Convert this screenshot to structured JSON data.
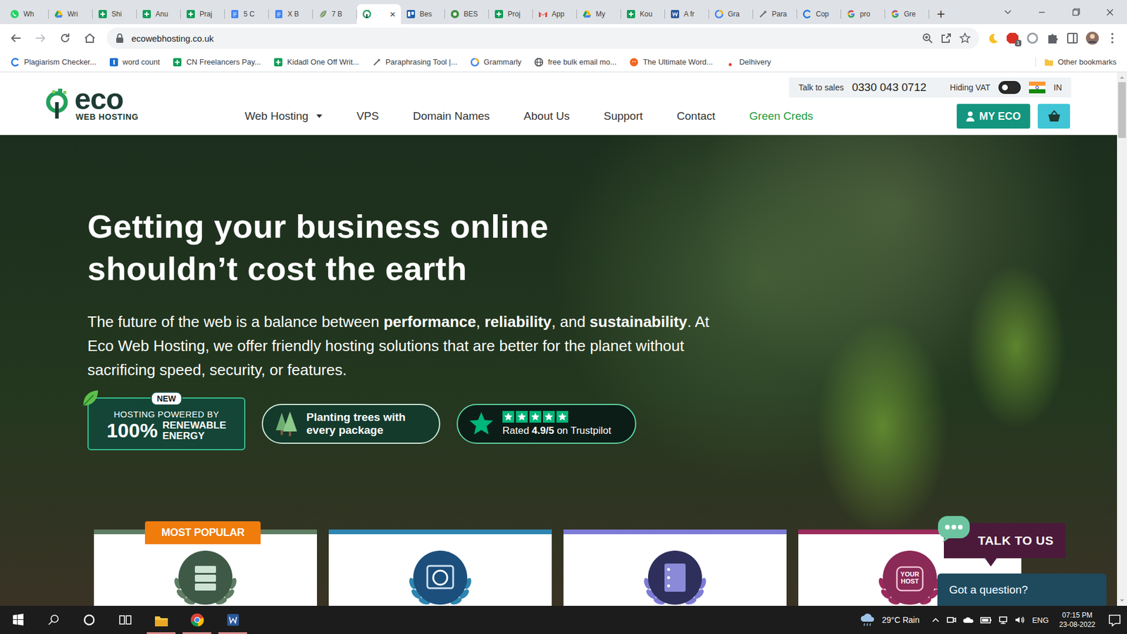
{
  "browser": {
    "tabs": [
      {
        "label": "Wh",
        "kind": "whatsapp",
        "selected": false
      },
      {
        "label": "Wri",
        "kind": "drive",
        "selected": false
      },
      {
        "label": "Shi",
        "kind": "sheets",
        "selected": false
      },
      {
        "label": "Anu",
        "kind": "sheets",
        "selected": false
      },
      {
        "label": "Praj",
        "kind": "sheets",
        "selected": false
      },
      {
        "label": "5 C",
        "kind": "docs",
        "selected": false
      },
      {
        "label": "X B",
        "kind": "docs",
        "selected": false
      },
      {
        "label": "7 B",
        "kind": "leaf",
        "selected": false
      },
      {
        "kind": "eco",
        "selected": true,
        "close": "×"
      },
      {
        "label": "Bes",
        "kind": "trello",
        "selected": false
      },
      {
        "label": "BES",
        "kind": "green-a",
        "selected": false
      },
      {
        "label": "Proj",
        "kind": "sheets",
        "selected": false
      },
      {
        "label": "App",
        "kind": "gmail",
        "selected": false
      },
      {
        "label": "My",
        "kind": "drive",
        "selected": false
      },
      {
        "label": "Kou",
        "kind": "sheets",
        "selected": false
      },
      {
        "label": "A fr",
        "kind": "word",
        "selected": false
      },
      {
        "label": "Gra",
        "kind": "ring",
        "selected": false
      },
      {
        "label": "Para",
        "kind": "pen",
        "selected": false
      },
      {
        "label": "Cop",
        "kind": "c",
        "selected": false
      },
      {
        "label": "pro",
        "kind": "google",
        "selected": false
      },
      {
        "label": "Gre",
        "kind": "google",
        "selected": false
      }
    ],
    "new_tab": "+",
    "address": "ecowebhosting.co.uk",
    "extension_badge": "1",
    "bookmarks": [
      {
        "label": "Plagiarism Checker...",
        "kind": "c"
      },
      {
        "label": "word count",
        "kind": "wordcount"
      },
      {
        "label": "CN Freelancers Pay...",
        "kind": "sheets"
      },
      {
        "label": "Kidadl One Off Writ...",
        "kind": "sheets"
      },
      {
        "label": "Paraphrasing Tool |...",
        "kind": "pen"
      },
      {
        "label": "Grammarly",
        "kind": "ring"
      },
      {
        "label": "free bulk email mo...",
        "kind": "globe"
      },
      {
        "label": "The Ultimate Word...",
        "kind": "orange"
      },
      {
        "label": "Delhivery",
        "kind": "dot"
      }
    ],
    "other_bookmarks": "Other bookmarks"
  },
  "site": {
    "sales_label": "Talk to sales",
    "sales_phone": "0330 043 0712",
    "vat": {
      "label": "Hiding VAT",
      "on": false
    },
    "country": "IN",
    "logo": {
      "word": "eco",
      "sub": "WEB HOSTING"
    },
    "nav": [
      {
        "label": "Web Hosting",
        "dropdown": true,
        "highlighted": false
      },
      {
        "label": "VPS",
        "dropdown": false,
        "highlighted": false
      },
      {
        "label": "Domain Names",
        "dropdown": false,
        "highlighted": false
      },
      {
        "label": "About Us",
        "dropdown": false,
        "highlighted": false
      },
      {
        "label": "Support",
        "dropdown": false,
        "highlighted": false
      },
      {
        "label": "Contact",
        "dropdown": false,
        "highlighted": false
      },
      {
        "label": "Green Creds",
        "dropdown": false,
        "highlighted": true
      }
    ],
    "account_button": "MY ECO",
    "hero": {
      "heading": [
        "Getting your business online",
        "shouldn’t cost the earth"
      ],
      "intro": [
        {
          "text": "The future of the web is a balance between ",
          "bold": false
        },
        {
          "text": "performance",
          "bold": true
        },
        {
          "text": ", ",
          "bold": false
        },
        {
          "text": "reliability",
          "bold": true
        },
        {
          "text": ", and ",
          "bold": false
        },
        {
          "text": "sustainability",
          "bold": true
        },
        {
          "text": ". At Eco Web Hosting, we offer friendly hosting solutions that are better for the planet without sacrificing speed, security, or features.",
          "bold": false
        }
      ]
    },
    "badges": {
      "renewable": {
        "new": "NEW",
        "top": "HOSTING POWERED BY",
        "figure": "100%",
        "lines": [
          "RENEWABLE",
          "ENERGY"
        ]
      },
      "trees": {
        "lines": [
          "Planting trees with",
          "every package"
        ]
      },
      "trustpilot": {
        "stars": 5,
        "rating": [
          {
            "text": "Rated ",
            "bold": false
          },
          {
            "text": "4.9/5",
            "bold": true
          },
          {
            "text": " on Trustpilot",
            "bold": false
          }
        ]
      }
    },
    "popular_label": "MOST POPULAR",
    "cards": [
      {
        "kind": "server",
        "color": "#5e7d63",
        "icon_color": "#3e5a47",
        "popular": true
      },
      {
        "kind": "wordpress",
        "color": "#2d86b0",
        "icon_color": "#1c4f7c",
        "popular": false
      },
      {
        "kind": "vps",
        "color": "#7d7bd6",
        "icon_color": "#2f2f5c",
        "popular": false
      },
      {
        "kind": "reseller",
        "color": "#9b2b5d",
        "icon_color": "#8a2a56",
        "popular": false,
        "icon_text": [
          "YOUR",
          "HOST"
        ]
      }
    ],
    "chat": {
      "button": "TALK TO US",
      "prompt": "Got a question?"
    },
    "scroll": 0
  },
  "taskbar": {
    "apps": [
      {
        "kind": "explorer",
        "open": true
      },
      {
        "kind": "chrome",
        "open": true
      },
      {
        "kind": "word",
        "open": true
      }
    ],
    "weather": "29°C Rain",
    "language": "ENG",
    "time": "07:15 PM",
    "date": "23-08-2022"
  }
}
